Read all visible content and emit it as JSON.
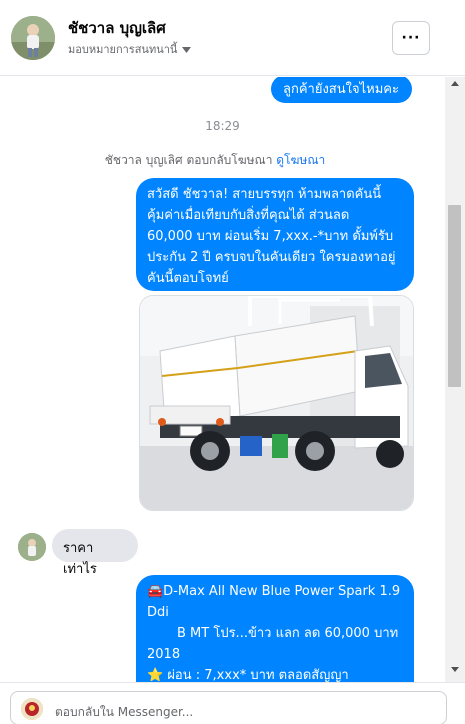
{
  "header": {
    "name": "ชัชวาล บุญเลิศ",
    "subtitle": "มอบหมายการสนทนานี้",
    "more_label": "···"
  },
  "thread": {
    "msg_top": "ลูกค้ายังสนใจไหมคะ",
    "time": "18:29",
    "reply_note_prefix": "ชัชวาล บุญเลิศ ตอบกลับโฆษณา",
    "reply_note_link": "ดูโฆษณา",
    "ad_message_lines": [
      "สวัสดี ชัชวาล! สายบรรทุก ห้ามพลาดคันนี้",
      "คุ้มค่าเมื่อเทียบกับสิ่งที่คุณได้ ส่วนลด",
      "60,000 บาท ผ่อนเริ่ม 7,xxx.-*บาท ดั้มพ์รับ",
      "ประกัน 2 ปี ครบจบในคันเดียว ใครมองหาอยู่",
      "คันนี้ตอบโจทย์"
    ],
    "price_question": "ราคาเท่าไร",
    "reply_lines": [
      "🚘D-Max All New Blue Power Spark 1.9",
      "Ddi",
      "B MT โปร...ข้าว แลก ลด 60,000 บาท",
      "2018",
      "⭐ ผ่อน : 7,xxx* บาท ตลอดสัญญา"
    ]
  },
  "composer": {
    "placeholder": "ตอบกลับใน Messenger..."
  },
  "colors": {
    "outgoing_bubble": "#0084ff",
    "incoming_bubble": "#e4e6eb",
    "link": "#1877f2"
  },
  "icons": {
    "more": "more-options-icon",
    "dropdown": "caret-down-icon"
  }
}
